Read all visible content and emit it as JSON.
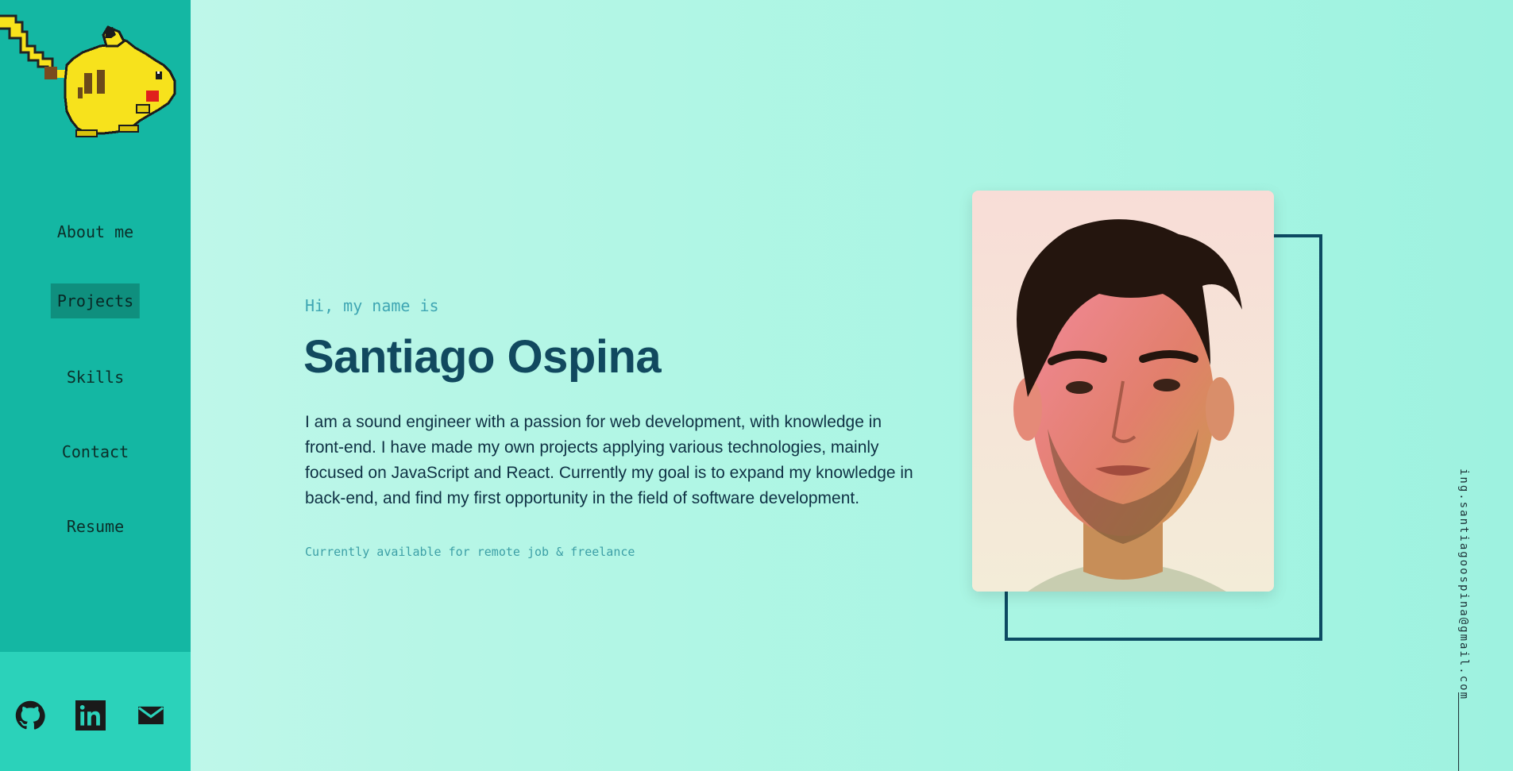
{
  "nav": {
    "items": [
      {
        "label": "About me"
      },
      {
        "label": "Projects",
        "active": true
      },
      {
        "label": "Skills"
      },
      {
        "label": "Contact"
      },
      {
        "label": "Resume"
      }
    ]
  },
  "social": {
    "icons": [
      "github-icon",
      "linkedin-icon",
      "mail-icon"
    ]
  },
  "hero": {
    "greeting": "Hi, my name is",
    "name": "Santiago Ospina",
    "bio": "I am a sound engineer with a passion for web development, with knowledge in front-end. I have made my own projects applying various technologies, mainly focused on JavaScript and React. Currently my goal is to expand my knowledge in back-end, and find my first opportunity in the field of software development.",
    "availability": "Currently available for remote job & freelance"
  },
  "contact": {
    "email": "ing.santiagoospina@gmail.com"
  },
  "colors": {
    "sidebar": "#14b7a3",
    "sidebar_footer": "#2bd2ba",
    "accent_dark": "#11495f",
    "nav_active": "#0f8f7e"
  }
}
